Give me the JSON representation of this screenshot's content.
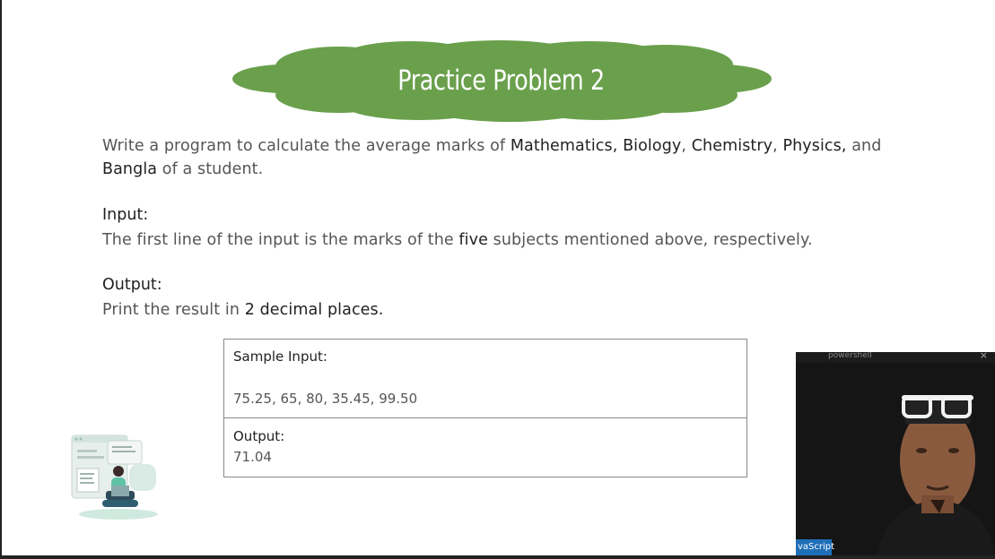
{
  "slide": {
    "title": "Practice Problem 2",
    "para1": {
      "prefix": "Write a program to calculate the average marks of ",
      "subj1": "Mathematics,",
      "subj2": "Biology",
      "sep1": ", ",
      "subj3": "Chemistry",
      "sep2": ", ",
      "subj4": "Physics,",
      "and": " and",
      "subj5": "Bangla",
      "suffix": " of a student."
    },
    "input_heading": "Input:",
    "input_text": {
      "prefix": "The first line of the input is the marks of the ",
      "bold": "five",
      "suffix": " subjects mentioned above, respectively."
    },
    "output_heading": "Output:",
    "output_text": {
      "prefix": "Print the result in ",
      "bold": "2 decimal places."
    },
    "sample": {
      "input_label": "Sample Input:",
      "input_value": "75.25, 65, 80, 35.45, 99.50",
      "output_label": "Output:",
      "output_value": "71.04"
    }
  },
  "webcam": {
    "toolbar_text": "powershell",
    "close": "×",
    "tag": "vaScript"
  },
  "colors": {
    "cloud": "#6aa04c",
    "text": "#555555",
    "bold": "#222222"
  }
}
